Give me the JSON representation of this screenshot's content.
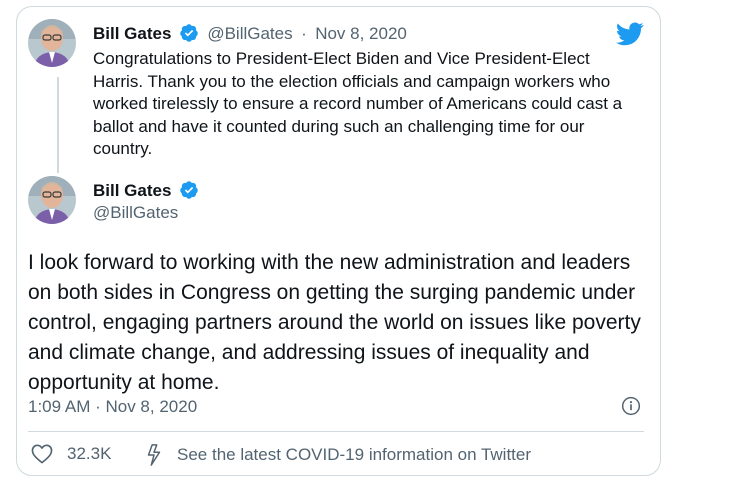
{
  "tweet_quoted": {
    "name": "Bill Gates",
    "handle": "@BillGates",
    "separator": "·",
    "date": "Nov 8, 2020",
    "text": "Congratulations to President-Elect Biden and Vice President-Elect Harris. Thank you to the election officials and campaign workers who worked tirelessly to ensure a record number of Americans could cast a ballot and have it counted during such an challenging time for our country."
  },
  "tweet_main": {
    "name": "Bill Gates",
    "handle": "@BillGates",
    "text": "I look forward to working with the new administration and leaders on both sides in Congress on getting the surging pandemic under control, engaging partners around the world on issues like poverty and climate change, and addressing issues of inequality and opportunity at home.",
    "timestamp": "1:09 AM · Nov 8, 2020"
  },
  "actions": {
    "like_count": "32.3K",
    "covid_link": "See the latest COVID-19 information on Twitter"
  },
  "icons": {
    "verified": "verified-badge-icon",
    "twitter": "twitter-bird-icon",
    "info": "info-icon",
    "heart": "heart-icon",
    "bolt": "lightning-icon"
  },
  "colors": {
    "twitter_blue": "#1d9bf0",
    "text_primary": "#0f1419",
    "text_secondary": "#536471",
    "border": "#cfd9de"
  }
}
